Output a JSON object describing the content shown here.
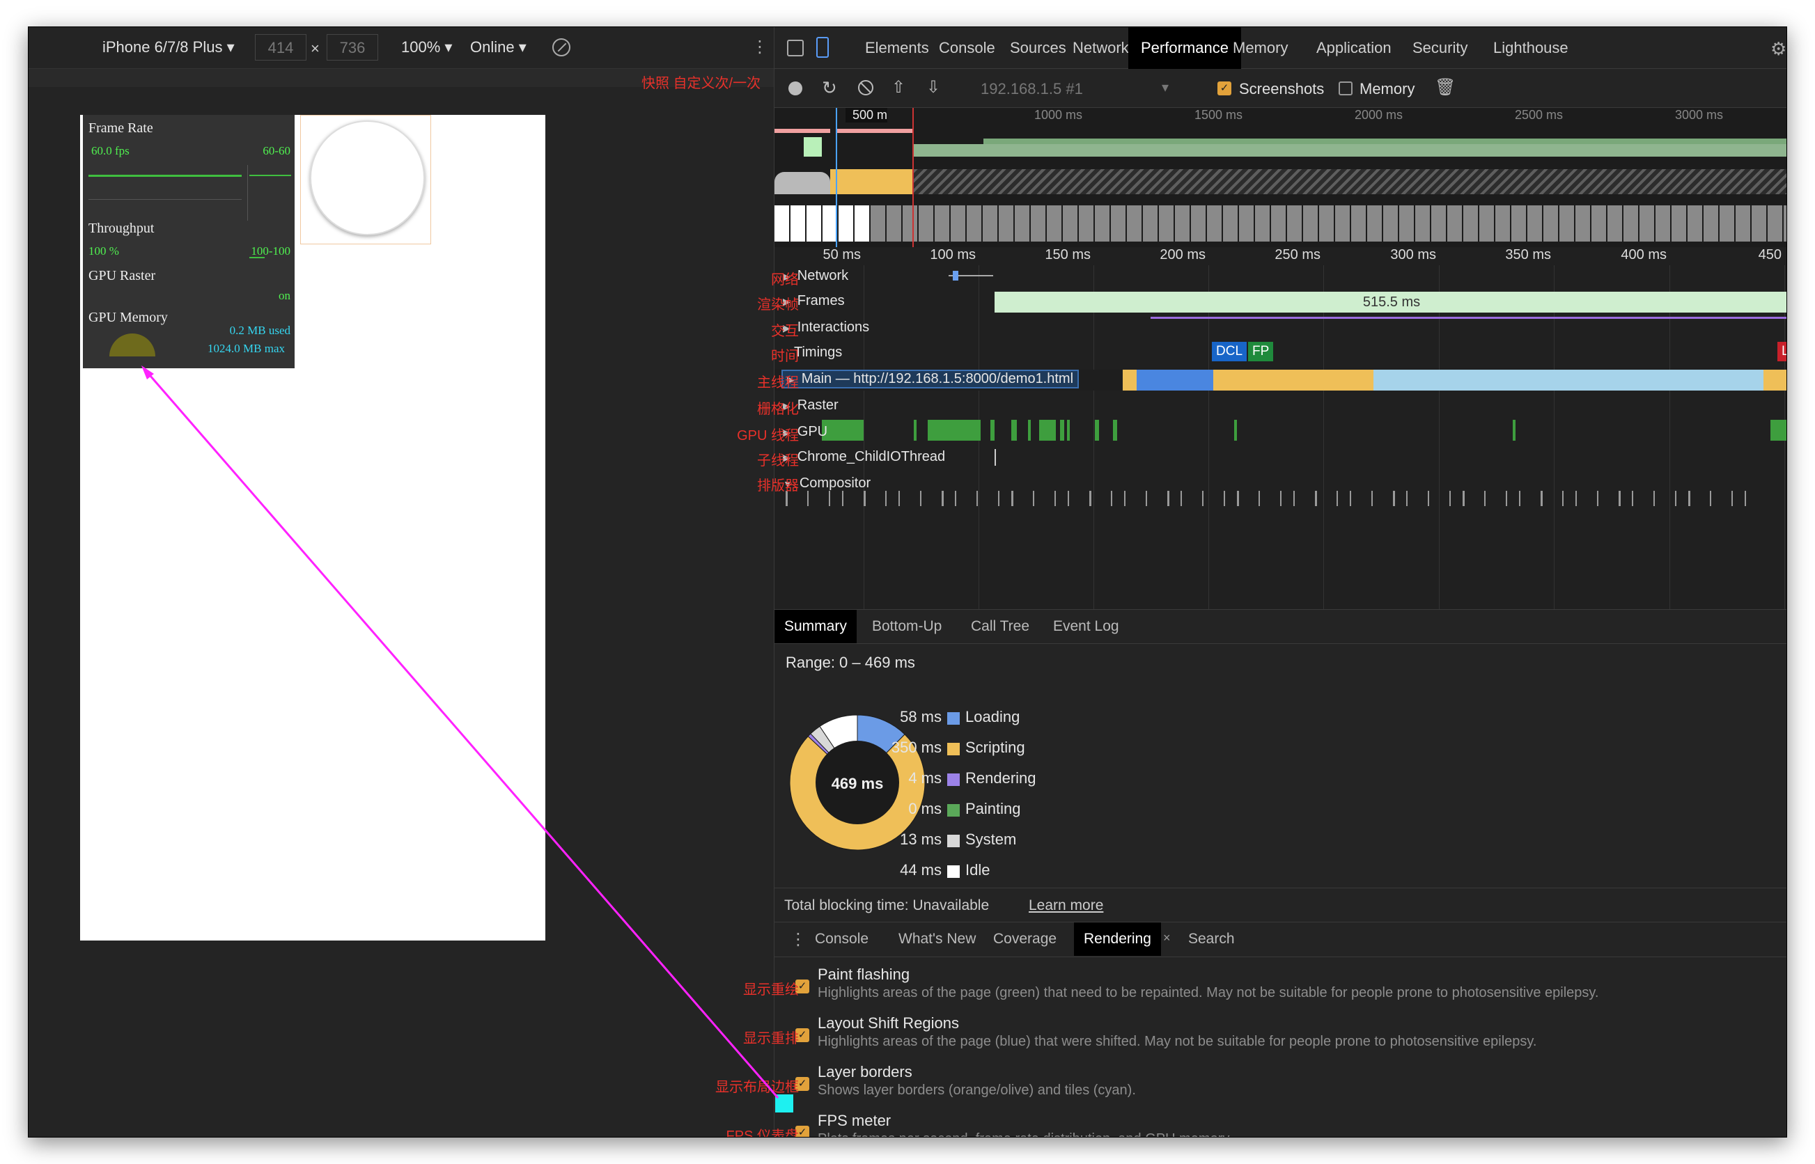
{
  "device_toolbar": {
    "device": "iPhone 6/7/8 Plus ▾",
    "width": "414",
    "times": "×",
    "height": "736",
    "zoom": "100% ▾",
    "network": "Online ▾",
    "snapshot_note": "快照 自定义次/一次"
  },
  "fps_hud": {
    "frame_rate_title": "Frame Rate",
    "fps": "60.0 fps",
    "fps_range": "60-60",
    "throughput_title": "Throughput",
    "throughput": "100 %",
    "throughput_range": "100-100",
    "gpu_raster_title": "GPU Raster",
    "gpu_raster_state": "on",
    "gpu_memory_title": "GPU Memory",
    "gpu_used": "0.2 MB used",
    "gpu_max": "1024.0 MB max"
  },
  "devtools": {
    "tabs": [
      "Elements",
      "Console",
      "Sources",
      "Network",
      "Performance",
      "Memory",
      "Application",
      "Security",
      "Lighthouse"
    ],
    "active_tab": "Performance",
    "recording_url": "192.168.1.5 #1",
    "screenshots_label": "Screenshots",
    "memory_label": "Memory",
    "overview_ticks": [
      "500 m",
      "1000 ms",
      "1500 ms",
      "2000 ms",
      "2500 ms",
      "3000 ms"
    ],
    "ruler_ticks": [
      "50 ms",
      "100 ms",
      "150 ms",
      "200 ms",
      "250 ms",
      "300 ms",
      "350 ms",
      "400 ms",
      "450"
    ],
    "tracks": {
      "network": "Network",
      "frames": "Frames",
      "interactions": "Interactions",
      "timings": "Timings",
      "main": "Main — http://192.168.1.5:8000/demo1.html",
      "raster": "Raster",
      "gpu": "GPU",
      "child_io": "Chrome_ChildIOThread",
      "compositor": "Compositor"
    },
    "frame_duration": "515.5 ms",
    "markers": {
      "dcl": "DCL",
      "fp": "FP",
      "l": "L"
    },
    "annotations": {
      "network": "网络",
      "frames": "渲染帧",
      "interactions": "交互",
      "timings": "时间",
      "main": "主线程",
      "raster": "栅格化",
      "gpu": "GPU 线程",
      "child": "子线程",
      "compositor": "排版器"
    },
    "bottom_tabs": [
      "Summary",
      "Bottom-Up",
      "Call Tree",
      "Event Log"
    ],
    "range": "Range: 0 – 469 ms",
    "donut_total": "469 ms",
    "summary": [
      {
        "value": "58 ms",
        "label": "Loading",
        "color": "#6b9be6"
      },
      {
        "value": "350 ms",
        "label": "Scripting",
        "color": "#efbf58"
      },
      {
        "value": "4 ms",
        "label": "Rendering",
        "color": "#9c82e8"
      },
      {
        "value": "0 ms",
        "label": "Painting",
        "color": "#5aa859"
      },
      {
        "value": "13 ms",
        "label": "System",
        "color": "#d8d8d8"
      },
      {
        "value": "44 ms",
        "label": "Idle",
        "color": "#ffffff"
      }
    ],
    "tbt": "Total blocking time: Unavailable",
    "learn_more": "Learn more",
    "drawer_tabs": [
      "Console",
      "What's New",
      "Coverage",
      "Rendering",
      "Search"
    ],
    "drawer_active": "Rendering",
    "options": [
      {
        "title": "Paint flashing",
        "desc": "Highlights areas of the page (green) that need to be repainted. May not be suitable for people prone to photosensitive epilepsy.",
        "note": "显示重绘"
      },
      {
        "title": "Layout Shift Regions",
        "desc": "Highlights areas of the page (blue) that were shifted. May not be suitable for people prone to photosensitive epilepsy.",
        "note": "显示重排"
      },
      {
        "title": "Layer borders",
        "desc": "Shows layer borders (orange/olive) and tiles (cyan).",
        "note": "显示布局边框"
      },
      {
        "title": "FPS meter",
        "desc": "Plots frames per second, frame rate distribution, and GPU memory.",
        "note": "FPS 仪表盘"
      }
    ]
  },
  "colors": {
    "accent": "#f0e020",
    "arrow": "#ff22ff",
    "annotation": "#e8312a"
  }
}
